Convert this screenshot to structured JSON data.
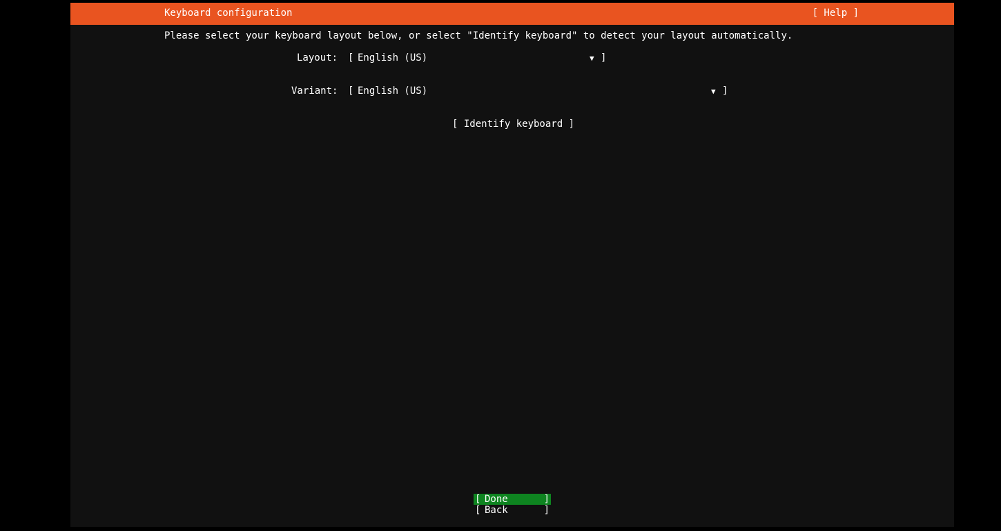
{
  "header": {
    "title": "Keyboard configuration",
    "help_label": "[ Help ]"
  },
  "instructions": "Please select your keyboard layout below, or select \"Identify keyboard\" to detect your layout automatically.",
  "form": {
    "layout": {
      "label": "Layout:",
      "value": "English (US)"
    },
    "variant": {
      "label": "Variant:",
      "value": "English (US)"
    },
    "identify_label": "[ Identify keyboard ]"
  },
  "buttons": {
    "done_label": "Done",
    "back_label": "Back"
  },
  "colors": {
    "header_orange": "#e95420",
    "focus_green": "#0e8420",
    "panel_background": "#111111"
  },
  "icons": {
    "dropdown": "triangle-down-icon"
  }
}
